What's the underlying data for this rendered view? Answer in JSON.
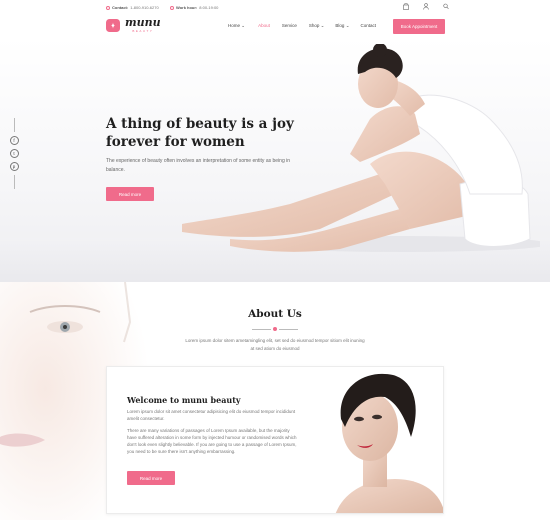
{
  "topbar": {
    "contact_label": "Contact:",
    "contact_value": "1-800-910-6270",
    "hours_label": "Work hour:",
    "hours_value": "8:00-19:00",
    "icons": [
      "bag-icon",
      "user-icon",
      "search-icon"
    ]
  },
  "brand": {
    "name": "munu",
    "sub": "BEAUTY",
    "accent": "#f06b8b"
  },
  "nav": {
    "items": [
      "Home",
      "About",
      "Service",
      "Shop",
      "Blog",
      "Contact"
    ],
    "active": "About",
    "appointment": "Book Appointment"
  },
  "hero": {
    "title": "A thing of beauty is a joy forever for women",
    "text": "The experience of beauty often involves an interpretation of some entity as being in balance.",
    "button": "Read more",
    "social": [
      "f",
      "t",
      "p"
    ]
  },
  "about": {
    "title": "About Us",
    "description": "Lorem ipsum dolor sitem ametamingling elit, set sed do eiusmod tempor sitiom elit inuning at sed atiom do eiusmod",
    "card_title": "Welcome to munu beauty",
    "card_p1": "Lorem ipsum dolor sit amet consectetur adipisicing elit do eiusmod tempor incididunt amelit consectetur.",
    "card_p2": "There are many variations of passages of Lorem Ipsum available, but the majority have suffered alteration in some form by injected humour or randomised words which don't look even slightly believable. If you are going to use a passage of Lorem Ipsum, you need to be sure there isn't anything embarrassing.",
    "card_button": "Read more"
  }
}
